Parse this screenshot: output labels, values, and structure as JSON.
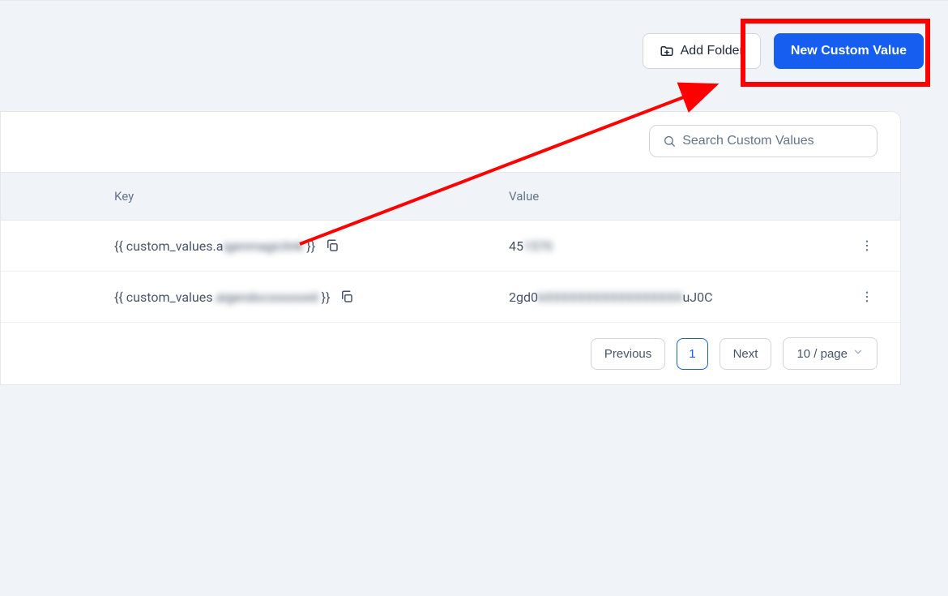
{
  "toolbar": {
    "addFolder": "Add Folder",
    "newCustomValue": "New Custom Value"
  },
  "search": {
    "placeholder": "Search Custom Values"
  },
  "table": {
    "headers": {
      "key": "Key",
      "value": "Value"
    },
    "rows": [
      {
        "key_prefix": "{{ custom_values.a",
        "key_blur": "igenmagiclink",
        "key_suffix": " }}",
        "value_prefix": "45",
        "value_blur": "1570",
        "value_suffix": ""
      },
      {
        "key_prefix": "{{ custom_values",
        "key_blur": ".aigendocxxxxxxid",
        "key_suffix": " }}",
        "value_prefix": "2gd0",
        "value_blur": "kXXXXXXXXXXXXXXXXX",
        "value_suffix": "uJ0C"
      }
    ]
  },
  "pagination": {
    "previous": "Previous",
    "page": "1",
    "next": "Next",
    "perPage": "10 / page"
  },
  "annotation": {
    "highlight_target": "new-custom-value-button"
  }
}
